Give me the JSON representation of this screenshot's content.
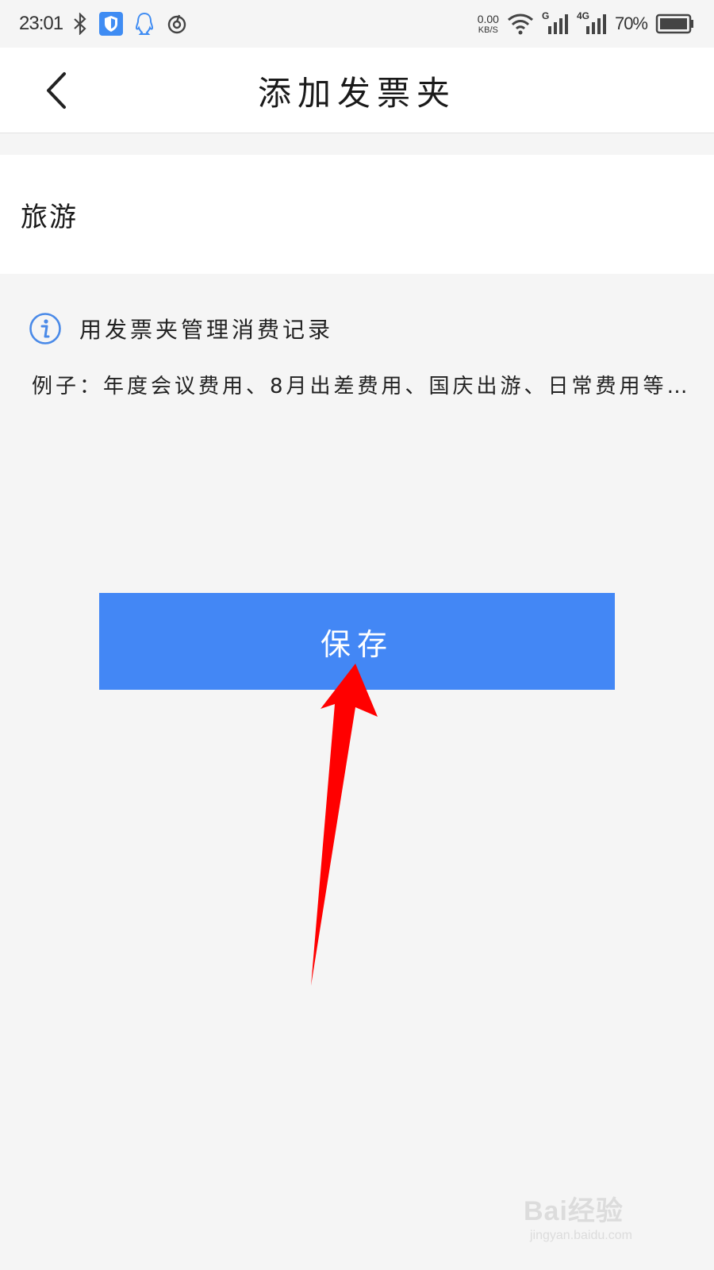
{
  "status_bar": {
    "time": "23:01",
    "net_speed_value": "0.00",
    "net_speed_unit": "KB/S",
    "signal_labels": [
      "G",
      "4G"
    ],
    "battery_percent": "70%",
    "icons": [
      "bluetooth-icon",
      "shield-icon",
      "qq-icon",
      "netease-music-icon",
      "wifi-icon",
      "signal-icon",
      "battery-icon"
    ]
  },
  "header": {
    "title": "添加发票夹",
    "back_icon": "chevron-left-icon"
  },
  "form": {
    "folder_name_value": "旅游"
  },
  "tip": {
    "icon": "info-icon",
    "title": "用发票夹管理消费记录",
    "example": "例子：年度会议费用、8月出差费用、国庆出游、日常费用等…"
  },
  "actions": {
    "save_label": "保存"
  },
  "watermark": {
    "brand": "Bai经验",
    "url": "jingyan.baidu.com"
  },
  "colors": {
    "accent": "#4387f5",
    "background": "#f5f5f5",
    "annotation": "#ff0000",
    "info_icon": "#4a8ae8"
  }
}
